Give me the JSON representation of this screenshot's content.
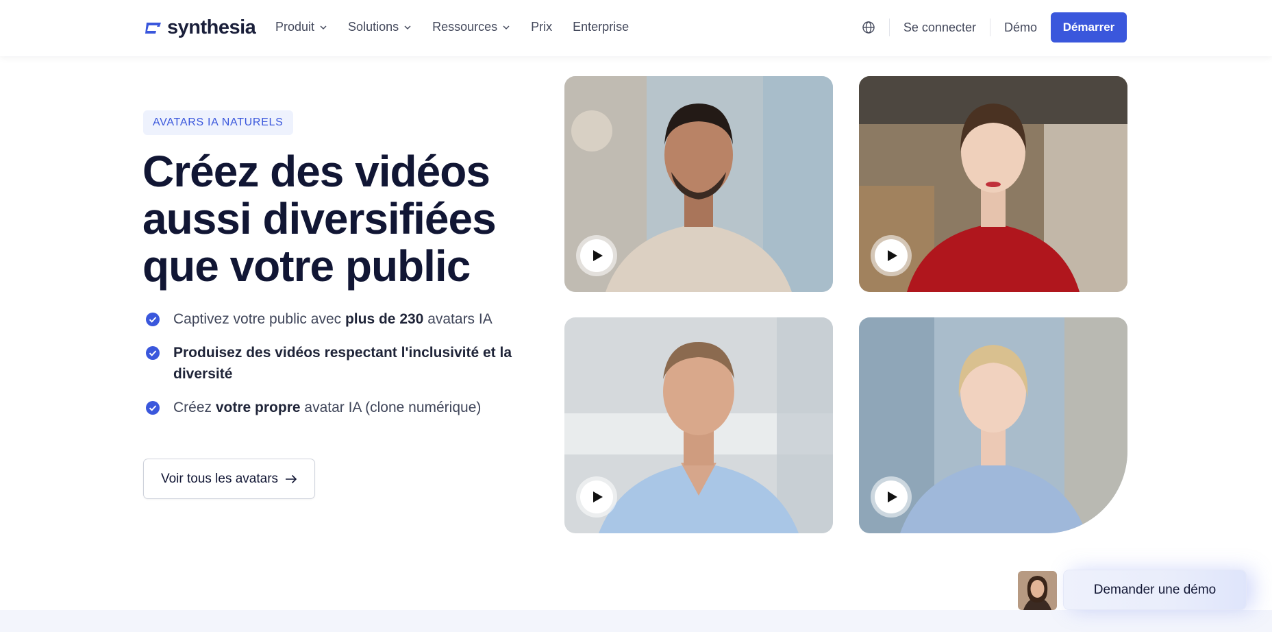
{
  "nav": {
    "logo_text": "synthesia",
    "menu": [
      {
        "label": "Produit",
        "dropdown": true
      },
      {
        "label": "Solutions",
        "dropdown": true
      },
      {
        "label": "Ressources",
        "dropdown": true
      },
      {
        "label": "Prix",
        "dropdown": false
      },
      {
        "label": "Enterprise",
        "dropdown": false
      }
    ],
    "login": "Se connecter",
    "demo": "Démo",
    "start": "Démarrer"
  },
  "hero": {
    "badge": "AVATARS IA NATURELS",
    "title": "Créez des vidéos aussi diversifiées que votre public",
    "features": [
      {
        "pre": "Captivez votre public avec ",
        "bold": "plus de 230",
        "post": " avatars IA"
      },
      {
        "pre": "",
        "bold": "Produisez des vidéos respectant l'inclusivité et la diversité",
        "post": ""
      },
      {
        "pre": "Créez ",
        "bold": "votre propre",
        "post": " avatar IA (clone numérique)"
      }
    ],
    "cta": "Voir tous les avatars"
  },
  "demo_request": "Demander une démo",
  "colors": {
    "accent": "#3a57dc",
    "heading": "#111634",
    "badge_bg": "#eef2fd"
  }
}
